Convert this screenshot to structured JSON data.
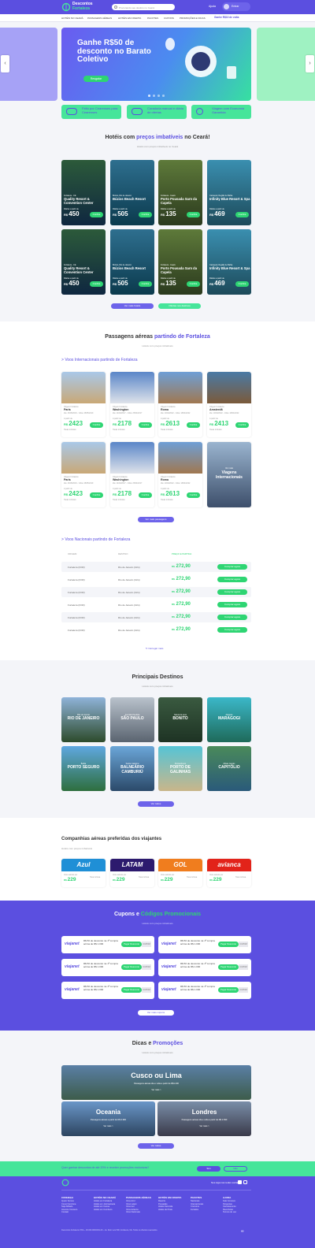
{
  "header": {
    "logo_line1": "Descontos",
    "logo_line2": "Fortaleza",
    "search_placeholder": "Procurando seu destino no Ceará",
    "help": "Ajuda",
    "login": "Entrar",
    "nav": [
      "HOTÉIS NO CEARÁ",
      "PASSAGENS AÉREAS",
      "HOTÉIS EM OFERTA",
      "PACOTES",
      "CUPONS",
      "PROMOÇÕES E DICAS"
    ],
    "cashback": "Ganhe R$10 de volta"
  },
  "hero": {
    "title": "Ganhe R$50 de desconto no Barato Coletivo",
    "button": "Resgatar",
    "prev": "‹",
    "next": "›"
  },
  "features": [
    {
      "icon": "pin-icon",
      "text": "Feito por Cearenses para Cearenses"
    },
    {
      "icon": "glasses-icon",
      "text": "Curadoria manual e diária de ofertas"
    },
    {
      "icon": "smile-icon",
      "text": "Viagem com Economia Garantida"
    }
  ],
  "hotels": {
    "title_prefix": "Hotéis com ",
    "title_highlight": "preços imbatíveis",
    "title_suffix": " no Ceará!",
    "subtitle": "Hotéis com preços imbatíveis no Ceará",
    "price_label": "Diárias a partir de",
    "book": "Confira",
    "more": "Ver mais hotéis",
    "offers": "Ofertas nos destinos",
    "items": [
      {
        "place": "Fortaleza - CE",
        "name": "Quality Resort & Convention Center",
        "price": "450",
        "c1": "#2c5a3a",
        "c2": "#0f2740"
      },
      {
        "place": "Búzios, Rio de Janeiro",
        "name": "Búzios Beach Resort",
        "price": "505",
        "c1": "#2e6f8f",
        "c2": "#0b3a4d"
      },
      {
        "place": "Fortaleza - Ceará",
        "name": "Porto Pousada Sarn da Capela",
        "price": "135",
        "c1": "#5e7a3a",
        "c2": "#2b3a1e"
      },
      {
        "place": "Camaçari, Região de Bahia",
        "name": "Infinity Blue Resort & Spa",
        "price": "469",
        "c1": "#3a8fb0",
        "c2": "#1d4a5a"
      },
      {
        "place": "Fortaleza - CE",
        "name": "Quality Resort & Convention Center",
        "price": "450",
        "c1": "#2c5a3a",
        "c2": "#0f2740"
      },
      {
        "place": "Búzios, Rio de Janeiro",
        "name": "Búzios Beach Resort",
        "price": "505",
        "c1": "#2e6f8f",
        "c2": "#0b3a4d"
      },
      {
        "place": "Fortaleza - Ceará",
        "name": "Porto Pousada Sarn da Capela",
        "price": "135",
        "c1": "#5e7a3a",
        "c2": "#2b3a1e"
      },
      {
        "place": "Camaçari, Região de Bahia",
        "name": "Infinity Blue Resort & Spa",
        "price": "469",
        "c1": "#3a8fb0",
        "c2": "#1d4a5a"
      }
    ]
  },
  "flights": {
    "title_prefix": "Passagens aéreas ",
    "title_highlight": "partindo de Fortaleza",
    "subtitle": "Hotéis com preços imbatíveis",
    "intl_prefix": "> ",
    "intl_label": "Voos Internacionais partindo de Fortaleza",
    "from_label": "Origem Fortaleza",
    "price_label": "A partir de",
    "fee_label": "Taxas inclusas",
    "book": "Confira",
    "more": "Ver mais passagens",
    "items": [
      {
        "city": "Paris",
        "dates": "Ida: 16/05/2019 - Volta: 28/05/2019",
        "price": "2423",
        "c1": "#a9c8e8",
        "c2": "#c9a876"
      },
      {
        "city": "Washington",
        "dates": "Ida: 14/04/2017 - Volta: 25/04/2017",
        "price": "2178",
        "c1": "#5a86c8",
        "c2": "#dfe3ea"
      },
      {
        "city": "Roma",
        "dates": "Ida: 10/04/2022 - Volta: 18/04/2022",
        "price": "2613",
        "c1": "#6e9fd6",
        "c2": "#a07850"
      },
      {
        "city": "Amsterdã",
        "dates": "Ida: 10/04/2022 - Volta: 18/04/2022",
        "price": "2413",
        "c1": "#4a7aa5",
        "c2": "#7b5a3a"
      },
      {
        "city": "Paris",
        "dates": "Ida: 16/05/2019 - Volta: 28/05/2019",
        "price": "2423",
        "c1": "#a9c8e8",
        "c2": "#c9a876"
      },
      {
        "city": "Washington",
        "dates": "Ida: 14/04/2017 - Volta: 25/04/2017",
        "price": "2178",
        "c1": "#5a86c8",
        "c2": "#dfe3ea"
      },
      {
        "city": "Roma",
        "dates": "Ida: 10/04/2022 - Volta: 18/04/2022",
        "price": "2613",
        "c1": "#6e9fd6",
        "c2": "#a07850"
      }
    ],
    "special_small": "Ver mais",
    "special_title": "Viagens Internacionais"
  },
  "national": {
    "prefix": "> ",
    "label": "Voos Nacionais partindo de Fortaleza",
    "headers": [
      "ORIGEM",
      "DESTINO",
      "PREÇO E PARTIDA"
    ],
    "rows": [
      {
        "origin": "Fortaleza (FOR)",
        "dest": "Rio de Janeiro (GIG)",
        "price": "272,90"
      },
      {
        "origin": "Fortaleza (FOR)",
        "dest": "Rio de Janeiro (GIG)",
        "price": "272,90"
      },
      {
        "origin": "Fortaleza (FOR)",
        "dest": "Rio de Janeiro (GIG)",
        "price": "272,90"
      },
      {
        "origin": "Fortaleza (FOR)",
        "dest": "Rio de Janeiro (GIG)",
        "price": "272,90"
      },
      {
        "origin": "Fortaleza (FOR)",
        "dest": "Rio de Janeiro (GIG)",
        "price": "272,90"
      },
      {
        "origin": "Fortaleza (FOR)",
        "dest": "Rio de Janeiro (GIG)",
        "price": "272,90"
      }
    ],
    "currency": "R$",
    "button": "Comprar agora",
    "load_more": "Carregar mais"
  },
  "destinations": {
    "title": "Principais Destinos",
    "subtitle": "Hotéis com preços imbatíveis",
    "more": "Ver todos",
    "items": [
      {
        "small": "Pão de Açúcar",
        "name": "RIO DE JANEIRO",
        "c1": "#8fb3d9",
        "c2": "#2d4b2b"
      },
      {
        "small": "Avenida Paulista",
        "name": "SÃO PAULO",
        "c1": "#b9c2cc",
        "c2": "#5a6470"
      },
      {
        "small": "Natureza pura",
        "name": "BONITO",
        "c1": "#3a5a40",
        "c2": "#1e3324"
      },
      {
        "small": "Alagoas",
        "name": "MARAGOGI",
        "c1": "#3bb8c9",
        "c2": "#1e6a5a"
      },
      {
        "small": "Bahia",
        "name": "PORTO SEGURO",
        "c1": "#5fa8e0",
        "c2": "#2e6f3e"
      },
      {
        "small": "Santa Catarina",
        "name": "BALNEÁRIO CAMBURIÚ",
        "c1": "#6ba6d8",
        "c2": "#2b4a6a"
      },
      {
        "small": "Pernambuco",
        "name": "PORTO DE GALINHAS",
        "c1": "#56c4d6",
        "c2": "#c9b68a"
      },
      {
        "small": "Minas Gerais",
        "name": "CAPITÓLIO",
        "c1": "#4a8a5a",
        "c2": "#2a5a7a"
      }
    ]
  },
  "airlines": {
    "title": "Companhias aéreas preferidas dos viajantes",
    "subtitle": "Hotéis com preços imbatíveis",
    "price_label": "Voos saindo por",
    "fee_label": "Taxa inclusa",
    "items": [
      {
        "name": "Azul",
        "color": "#1f8fd6",
        "price": "229"
      },
      {
        "name": "LATAM",
        "color": "#2c1a6e",
        "price": "229"
      },
      {
        "name": "GOL",
        "color": "#f07d1e",
        "price": "229"
      },
      {
        "name": "avianca",
        "color": "#e2231a",
        "price": "229"
      }
    ]
  },
  "coupons": {
    "title_prefix": "Cupons e ",
    "title_highlight": "Códigos Promocionais",
    "subtitle": "Hotéis com preços imbatíveis",
    "logo": "viajanet",
    "text": "R$ 50 de desconto na 1ª compra acima de R$ 1.000",
    "button": "Pegar Desconto",
    "code": "CUPOM",
    "more": "Ver mais cupons",
    "count": 6
  },
  "tips": {
    "title_prefix": "Dicas e ",
    "title_highlight": "Promoções",
    "subtitle": "Hotéis com preços imbatíveis",
    "big": {
      "name": "Cusco ou Lima",
      "text": "Passagens aéreas ida e volta a partir de R$1.200",
      "link": "Ver mais >"
    },
    "small": [
      {
        "name": "Oceania",
        "text": "Passagens aéreas a partir de R$ 3.990",
        "link": "Ver mais >"
      },
      {
        "name": "Londres",
        "text": "Passagens aéreas ida e volta a partir de R$ 2.990",
        "link": "Ver mais >"
      }
    ],
    "more": "Ver todas"
  },
  "newsletter": {
    "question": "Quer ganhar descontos de até 20% e receber promoções exclusivas?",
    "yes": "Sim",
    "no": "Não"
  },
  "footer": {
    "social": "Nos siga nas redes sociais",
    "columns": [
      {
        "title": "CONHEÇA",
        "items": [
          "Quem Somos",
          "Como Funciona",
          "Seja Afiliado",
          "Anuncie Conosco",
          "Contato"
        ]
      },
      {
        "title": "HOTÉIS NO CEARÁ",
        "items": [
          "Hotéis em Fortaleza",
          "Hotéis em Jericoacoara",
          "Hotéis em Canoa",
          "Hotéis em Cumbuco"
        ]
      },
      {
        "title": "PASSAGENS AÉREAS",
        "items": [
          "Voos Azul",
          "Voos Latam",
          "Voos Gol",
          "Voos Avianca",
          "Voos Nacionais"
        ]
      },
      {
        "title": "HOTÉIS EM OFERTA",
        "items": [
          "Resorts",
          "Pousadas",
          "Hotéis Fazenda",
          "Hotéis de Praia"
        ]
      },
      {
        "title": "PACOTES",
        "items": [
          "Nacionais",
          "Internacionais",
          "Cruzeiros",
          "Feriados"
        ]
      },
      {
        "title": "AJUDA",
        "items": [
          "Fale Conosco",
          "Perguntas",
          "Cancelamento",
          "Reembolso",
          "Termos de uso"
        ]
      }
    ],
    "legal": "Descontos Fortaleza LTDA – 00.000.000/0001-00 – Av. Dom Luís 500, Fortaleza, CE. Todos os direitos reservados."
  },
  "colors": {
    "purple": "#5b4fe0",
    "green": "#2ed573",
    "mint": "#46e59a"
  }
}
